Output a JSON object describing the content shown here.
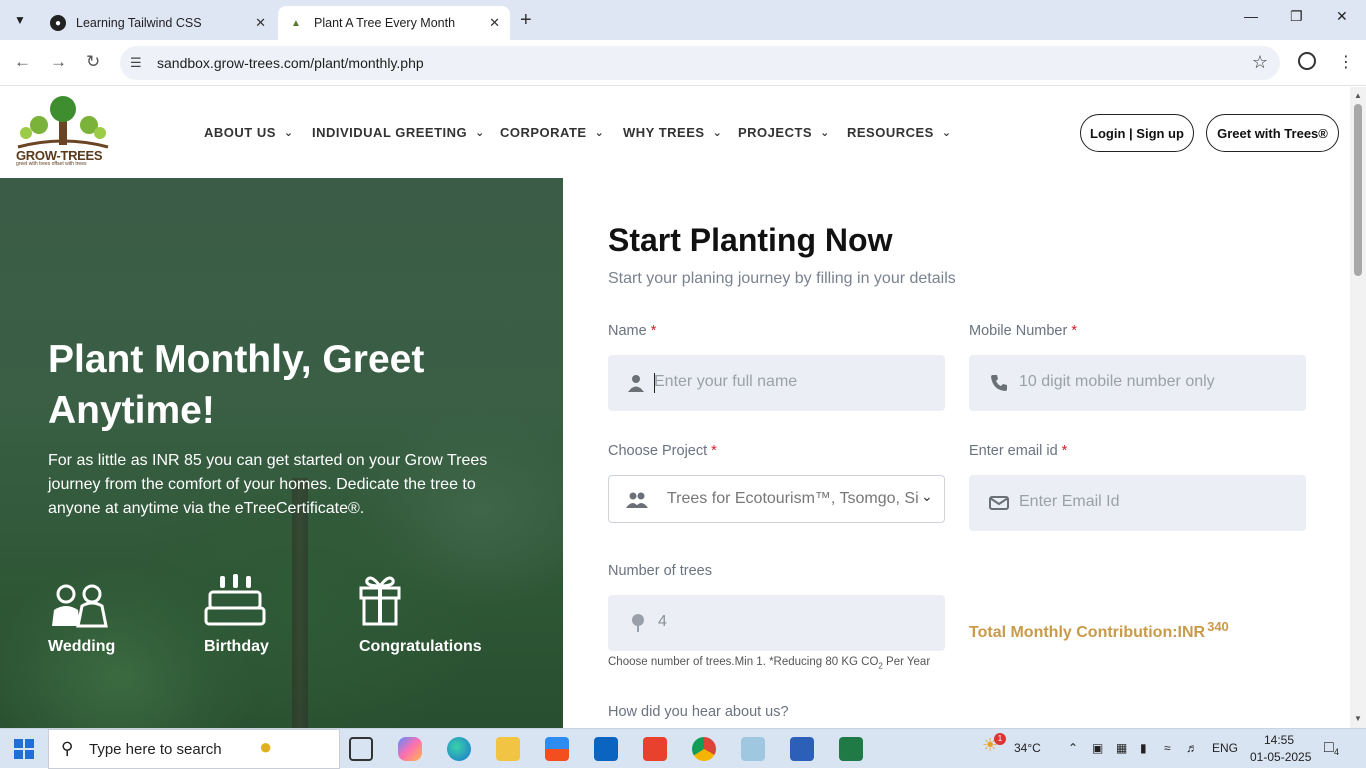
{
  "browser": {
    "tabs": [
      {
        "title": "Learning Tailwind CSS",
        "active": false
      },
      {
        "title": "Plant A Tree Every Month",
        "active": true
      }
    ],
    "url": "sandbox.grow-trees.com/plant/monthly.php"
  },
  "site": {
    "logo_text": "GROW-TREES",
    "logo_tagline": "greet with trees offset with trees",
    "nav": [
      "ABOUT US",
      "INDIVIDUAL GREETING",
      "CORPORATE",
      "WHY TREES",
      "PROJECTS",
      "RESOURCES"
    ],
    "login_label": "Login | Sign up",
    "greet_label": "Greet with Trees®"
  },
  "hero": {
    "title": "Plant Monthly, Greet Anytime!",
    "description": "For as little as INR 85 you can get started on your Grow Trees journey from the comfort of your homes. Dedicate the tree to anyone at anytime via the eTreeCertificate®.",
    "occasions": [
      "Wedding",
      "Birthday",
      "Congratulations"
    ]
  },
  "form": {
    "title": "Start Planting Now",
    "subtitle": "Start your planing journey by filling in your details",
    "name_label": "Name",
    "name_placeholder": "Enter your full name",
    "mobile_label": "Mobile Number",
    "mobile_placeholder": "10 digit mobile number only",
    "project_label": "Choose Project",
    "project_value": "Trees for Ecotourism™, Tsomgo, Sikkim",
    "email_label": "Enter email id",
    "email_placeholder": "Enter Email Id",
    "trees_label": "Number of trees",
    "trees_value": "4",
    "contribution_label": "Total Monthly Contribution:INR",
    "contribution_value": "340",
    "helper_text": "Choose number of trees.Min 1. *Reducing 80 KG CO",
    "helper_sub": "2",
    "helper_tail": " Per Year",
    "hear_label": "How did you hear about us?",
    "required_mark": "*"
  },
  "taskbar": {
    "search_placeholder": "Type here to search",
    "weather": "34°C",
    "language": "ENG",
    "time": "14:55",
    "date": "01-05-2025",
    "weather_badge": "1",
    "notif_count": "4"
  }
}
